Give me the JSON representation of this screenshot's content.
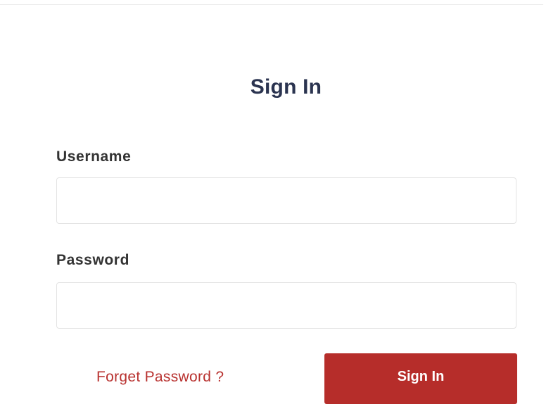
{
  "form": {
    "title": "Sign In",
    "username_label": "Username",
    "username_value": "",
    "password_label": "Password",
    "password_value": "",
    "forgot_link": "Forget Password ?",
    "submit_label": "Sign In"
  },
  "colors": {
    "accent": "#b62d2a",
    "link": "#b8312f",
    "title": "#2b3450",
    "label": "#333333",
    "input_border": "#e3e3e3"
  }
}
